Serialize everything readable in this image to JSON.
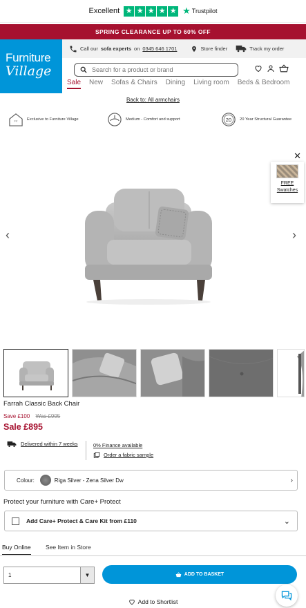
{
  "trustpilot": {
    "rating_text": "Excellent",
    "stars": 5,
    "brand": "Trustpilot"
  },
  "promo": {
    "text": "SPRING CLEARANCE UP TO 60% OFF"
  },
  "logo": {
    "line1": "Furniture",
    "line2": "Village"
  },
  "topbar": {
    "call_prefix": "Call our",
    "call_bold": "sofa experts",
    "call_on": "on",
    "phone": "0345 646 1701",
    "store_finder": "Store finder",
    "track_order": "Track my order"
  },
  "search": {
    "placeholder": "Search for a product or brand"
  },
  "nav": [
    "Sale",
    "New",
    "Sofas & Chairs",
    "Dining",
    "Living room",
    "Beds & Bedroom"
  ],
  "back_link": "Back to: All armchairs",
  "usps": {
    "u1": "Exclusive to Furniture Village",
    "u2": "Medium - Comfort and support",
    "u3_badge": "20",
    "u3": "20 Year Structural Guarantee"
  },
  "swatches": {
    "line1": "FREE",
    "line2": "Swatches"
  },
  "product": {
    "title": "Farrah Classic Back Chair",
    "save": "Save £100",
    "was": "Was £995",
    "price": "Sale £895"
  },
  "delivery": {
    "text": "Delivered within 7 weeks"
  },
  "finance": {
    "finance": "0% Finance available",
    "sample": "Order a fabric sample"
  },
  "colour": {
    "label": "Colour:",
    "value": "Riga Silver - Zena Silver Dw"
  },
  "protect": {
    "heading": "Protect your furniture with Care+ Protect",
    "option": "Add Care+ Protect & Care Kit from £110"
  },
  "tabs": [
    "Buy Online",
    "See Item in Store"
  ],
  "quantity": {
    "value": "1"
  },
  "basket": {
    "label": "ADD TO BASKET"
  },
  "shortlist": {
    "label": "Add to Shortlist"
  },
  "colors": {
    "brand_blue": "#0095d9",
    "sale_red": "#a6112f",
    "trustpilot_green": "#00b67a"
  }
}
